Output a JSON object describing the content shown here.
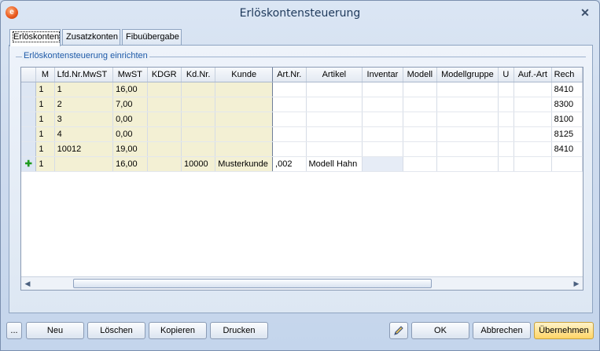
{
  "window": {
    "title": "Erlöskontensteuerung"
  },
  "tabs": [
    {
      "label": "Erlöskonten"
    },
    {
      "label": "Zusatzkonten"
    },
    {
      "label": "Fibuübergabe"
    }
  ],
  "group": {
    "label": "Erlöskontensteuerung einrichten"
  },
  "grid": {
    "columns": [
      "M",
      "Lfd.Nr.MwST",
      "MwST",
      "KDGR",
      "Kd.Nr.",
      "Kunde",
      "Art.Nr.",
      "Artikel",
      "Inventar",
      "Modell",
      "Modellgruppe",
      "U",
      "Auf.-Art",
      "Rech"
    ],
    "rows": [
      [
        "1",
        "1",
        "16,00",
        "",
        "",
        "",
        "",
        "",
        "",
        "",
        "",
        "",
        "",
        "8410"
      ],
      [
        "1",
        "2",
        "7,00",
        "",
        "",
        "",
        "",
        "",
        "",
        "",
        "",
        "",
        "",
        "8300"
      ],
      [
        "1",
        "3",
        "0,00",
        "",
        "",
        "",
        "",
        "",
        "",
        "",
        "",
        "",
        "",
        "8100"
      ],
      [
        "1",
        "4",
        "0,00",
        "",
        "",
        "",
        "",
        "",
        "",
        "",
        "",
        "",
        "",
        "8125"
      ],
      [
        "1",
        "10012",
        "19,00",
        "",
        "",
        "",
        "",
        "",
        "",
        "",
        "",
        "",
        "",
        "8410"
      ],
      [
        "1",
        "",
        "16,00",
        "",
        "10000",
        "Musterkunde",
        ",002",
        "Modell Hahn",
        "",
        "",
        "",
        "",
        "",
        ""
      ]
    ]
  },
  "buttons": {
    "more": "...",
    "new": "Neu",
    "delete": "Löschen",
    "copy": "Kopieren",
    "print": "Drucken",
    "ok": "OK",
    "cancel": "Abbrechen",
    "apply": "Übernehmen"
  },
  "icons": {
    "new_row": "plus-icon",
    "edit": "pencil-icon",
    "close": "close-icon"
  }
}
